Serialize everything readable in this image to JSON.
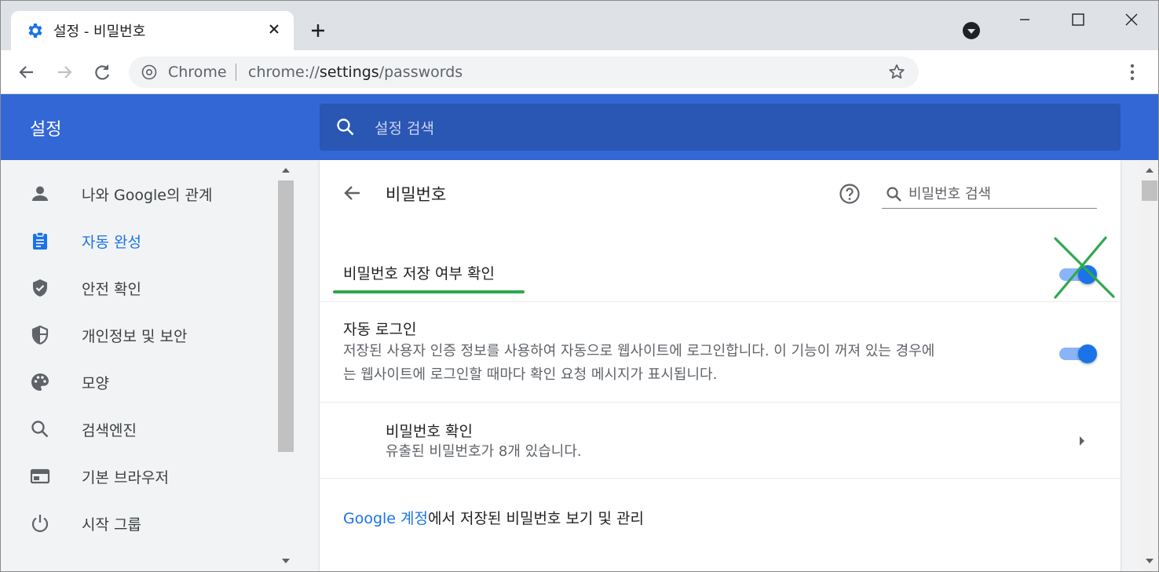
{
  "tab": {
    "title": "설정 - 비밀번호",
    "icon": "gear-icon"
  },
  "toolbar": {
    "omnibox_scheme_label": "Chrome",
    "url_prefix": "chrome://",
    "url_host": "settings",
    "url_path": "/passwords"
  },
  "header": {
    "title": "설정",
    "search_placeholder": "설정 검색"
  },
  "sidebar": {
    "items": [
      {
        "label": "나와 Google의 관계",
        "icon": "person-icon"
      },
      {
        "label": "자동 완성",
        "icon": "clipboard-icon",
        "active": true
      },
      {
        "label": "안전 확인",
        "icon": "shield-check-icon"
      },
      {
        "label": "개인정보 및 보안",
        "icon": "shield-half-icon"
      },
      {
        "label": "모양",
        "icon": "palette-icon"
      },
      {
        "label": "검색엔진",
        "icon": "search-icon"
      },
      {
        "label": "기본 브라우저",
        "icon": "browser-icon"
      },
      {
        "label": "시작 그룹",
        "icon": "power-icon"
      }
    ]
  },
  "page": {
    "title": "비밀번호",
    "search_placeholder": "비밀번호 검색",
    "offer_to_save": {
      "label": "비밀번호 저장 여부 확인",
      "enabled": true
    },
    "auto_signin": {
      "label": "자동 로그인",
      "desc_line1": "저장된 사용자 인증 정보를 사용하여 자동으로 웹사이트에 로그인합니다. 이 기능이 꺼져 있는 경우에",
      "desc_line2": "는 웹사이트에 로그인할 때마다 확인 요청 메시지가 표시됩니다.",
      "enabled": true
    },
    "check_passwords": {
      "label": "비밀번호 확인",
      "desc": "유출된 비밀번호가 8개 있습니다."
    },
    "manage_link": {
      "link_text": "Google 계정",
      "rest_text": "에서 저장된 비밀번호 보기 및 관리"
    }
  },
  "colors": {
    "header_blue": "#3367d6",
    "accent": "#1a73e8",
    "annotation_green": "#2fa84f"
  }
}
